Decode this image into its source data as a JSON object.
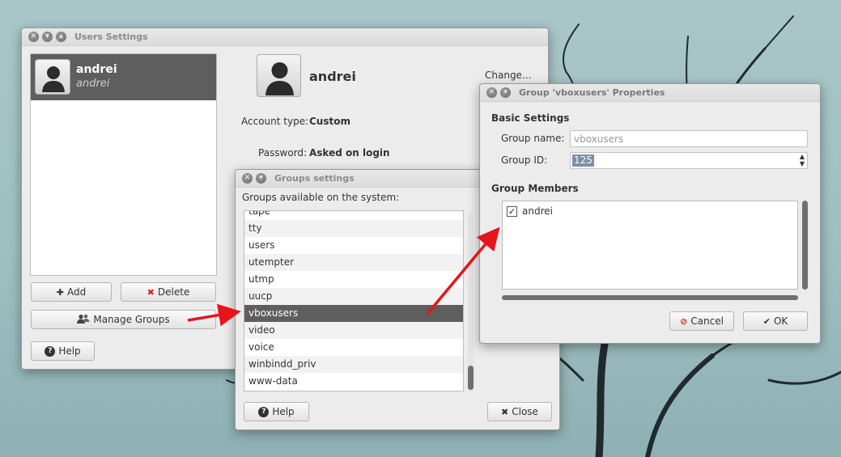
{
  "users_window": {
    "title": "Users Settings",
    "user_list": [
      {
        "name": "andrei",
        "fullname": "andrei"
      }
    ],
    "selected_user": "andrei",
    "change_label": "Change...",
    "account_type_label": "Account type:",
    "account_type_value": "Custom",
    "password_label": "Password:",
    "password_value": "Asked on login",
    "add_label": "Add",
    "delete_label": "Delete",
    "manage_groups_label": "Manage Groups",
    "help_label": "Help"
  },
  "groups_window": {
    "title": "Groups settings",
    "heading": "Groups available on the system:",
    "groups": [
      "tape",
      "tty",
      "users",
      "utempter",
      "utmp",
      "uucp",
      "vboxusers",
      "video",
      "voice",
      "winbindd_priv",
      "www-data"
    ],
    "selected_group": "vboxusers",
    "help_label": "Help",
    "close_label": "Close"
  },
  "props_window": {
    "title": "Group 'vboxusers' Properties",
    "basic_heading": "Basic Settings",
    "group_name_label": "Group name:",
    "group_name_value": "vboxusers",
    "group_id_label": "Group ID:",
    "group_id_value": "125",
    "members_heading": "Group Members",
    "members": [
      {
        "name": "andrei",
        "checked": true
      }
    ],
    "cancel_label": "Cancel",
    "ok_label": "OK"
  },
  "colors": {
    "selection": "#5e5e5e",
    "annotation_arrow": "#e8141b",
    "cancel_icon": "#d4262a",
    "delete_icon": "#d4262a"
  }
}
